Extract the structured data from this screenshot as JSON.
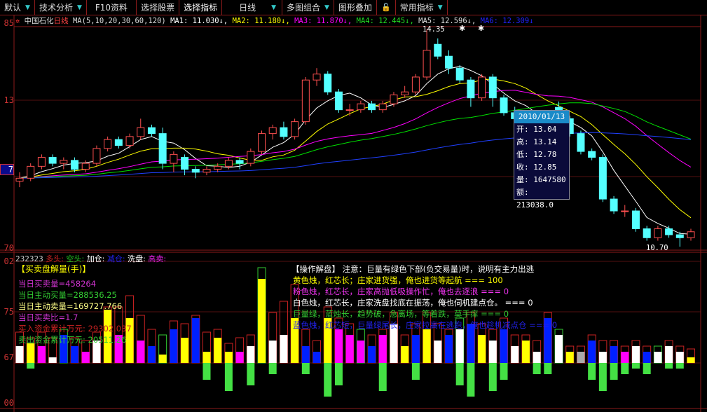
{
  "toolbar": {
    "items": [
      "默认",
      "技术分析",
      "F10资料",
      "选择股票",
      "选择指标",
      "日线",
      "多图组合",
      "图形叠加",
      "常用指标"
    ]
  },
  "info": {
    "stock": "中国石化",
    "period": "日线",
    "ma_params": "MA(5,10,20,30,60,120)",
    "ma1": "MA1: 11.030↓,",
    "ma2": "MA2: 11.180↓,",
    "ma3": "MA3: 11.870↓,",
    "ma4": "MA4: 12.445↓,",
    "ma5": "MA5: 12.596↓,",
    "ma6": "MA6: 12.309↓"
  },
  "axis": {
    "left_price": [
      "85",
      "13",
      "7",
      "70"
    ],
    "left_volume": [
      "02",
      "75",
      "67",
      "00"
    ]
  },
  "annotations": {
    "high": "14.35",
    "low": "10.70"
  },
  "tooltip": {
    "date": "2010/01/13",
    "open": "开: 13.04",
    "high": "高: 13.14",
    "low": "低: 12.78",
    "close": "收: 12.85",
    "volume": "量: 1647580",
    "amount": "额: 213038.0"
  },
  "volume_header": {
    "code": "232323",
    "items": [
      "多头:",
      "空头:",
      "加仓:",
      "减仓:",
      "洗盘:",
      "高卖:"
    ]
  },
  "left_panel": {
    "title": "【买卖盘解量(手)】",
    "lines": [
      "当日买卖量=458264",
      "当日主动买量=288536.25",
      "当日主动卖量=169727.766",
      "当日买卖比=1.7",
      "买入资金累计万元: 29302.037",
      "卖出资金累计万元: 20511.26"
    ]
  },
  "right_panel": {
    "title": "【操作解盘】 注意：巨量有绿色下部(负交易量)时，说明有主力出逃",
    "lines": [
      "黄色烛，红芯长；庄家进货强，俺也进货等起航 === 100",
      "粉色烛，红芯长，庄家高抛低吸操作忙，俺也去逐浪 === 0",
      "白色烛，红芯长，庄家洗盘找底在振荡，俺也伺机建点仓。 === 0",
      "巨量绿，蓝烛长，趋势破，急离场，等着跌，莫手痒 === 0",
      "蓝色烛，红芯短，巨量绿尾长，庄家拉高在逃跑，俺也趁机减点仓 === 0"
    ]
  },
  "colors": {
    "up": "#ff5050",
    "down": "#54ffff",
    "ma1": "#ffffff",
    "ma2": "#ffff00",
    "ma3": "#ff00ff",
    "ma4": "#00e000",
    "ma5": "#ffffff",
    "ma6": "#2040ff"
  },
  "chart_data": {
    "type": "candlestick",
    "price_range": [
      10.7,
      14.35
    ],
    "candles": [
      [
        11.8,
        11.95,
        11.7,
        11.85
      ],
      [
        11.85,
        12.1,
        11.8,
        12.05
      ],
      [
        12.05,
        12.25,
        12.0,
        12.2
      ],
      [
        12.2,
        12.25,
        12.05,
        12.1
      ],
      [
        12.1,
        12.2,
        12.0,
        12.15
      ],
      [
        12.15,
        12.2,
        11.95,
        12.0
      ],
      [
        12.0,
        12.15,
        11.95,
        12.1
      ],
      [
        12.1,
        12.4,
        12.05,
        12.35
      ],
      [
        12.35,
        12.55,
        12.3,
        12.5
      ],
      [
        12.5,
        12.55,
        12.35,
        12.4
      ],
      [
        12.4,
        12.6,
        12.35,
        12.55
      ],
      [
        12.55,
        12.85,
        12.5,
        12.7
      ],
      [
        12.7,
        12.75,
        12.55,
        12.6
      ],
      [
        12.6,
        12.7,
        12.0,
        12.1
      ],
      [
        12.1,
        12.3,
        11.95,
        12.25
      ],
      [
        12.2,
        12.25,
        11.9,
        12.0
      ],
      [
        12.0,
        12.05,
        11.85,
        11.95
      ],
      [
        11.95,
        12.05,
        11.9,
        12.0
      ],
      [
        12.0,
        12.1,
        11.95,
        12.05
      ],
      [
        12.05,
        12.2,
        12.0,
        12.15
      ],
      [
        12.15,
        12.2,
        12.0,
        12.1
      ],
      [
        12.1,
        12.35,
        12.05,
        12.3
      ],
      [
        12.3,
        12.65,
        12.25,
        12.6
      ],
      [
        12.6,
        12.75,
        12.5,
        12.7
      ],
      [
        12.7,
        12.8,
        12.5,
        12.55
      ],
      [
        12.55,
        12.85,
        12.5,
        12.8
      ],
      [
        12.8,
        13.55,
        12.75,
        13.5
      ],
      [
        13.5,
        13.7,
        13.4,
        13.6
      ],
      [
        13.6,
        13.65,
        13.25,
        13.3
      ],
      [
        13.3,
        13.35,
        12.95,
        13.0
      ],
      [
        13.0,
        13.1,
        12.9,
        13.0
      ],
      [
        13.0,
        13.15,
        12.95,
        13.1
      ],
      [
        13.1,
        13.15,
        12.95,
        13.0
      ],
      [
        13.0,
        13.15,
        12.95,
        13.1
      ],
      [
        13.1,
        13.3,
        13.05,
        13.25
      ],
      [
        13.25,
        13.4,
        13.2,
        13.3
      ],
      [
        13.3,
        13.6,
        13.25,
        13.55
      ],
      [
        13.55,
        14.35,
        13.5,
        14.0
      ],
      [
        14.1,
        14.2,
        13.85,
        13.9
      ],
      [
        13.9,
        14.0,
        13.6,
        13.7
      ],
      [
        13.7,
        13.75,
        13.45,
        13.5
      ],
      [
        13.5,
        13.55,
        13.05,
        13.2
      ],
      [
        13.2,
        13.6,
        13.15,
        13.55
      ],
      [
        13.55,
        13.6,
        13.05,
        13.2
      ],
      [
        13.2,
        13.25,
        12.9,
        12.95
      ],
      [
        12.95,
        13.05,
        12.8,
        12.85
      ],
      [
        12.85,
        12.95,
        12.75,
        12.8
      ],
      [
        12.8,
        12.95,
        12.75,
        12.9
      ],
      [
        12.9,
        12.95,
        12.8,
        12.85
      ],
      [
        13.04,
        13.14,
        12.78,
        12.85
      ],
      [
        12.85,
        12.9,
        12.55,
        12.6
      ],
      [
        12.6,
        12.65,
        12.25,
        12.3
      ],
      [
        12.3,
        12.35,
        12.15,
        12.2
      ],
      [
        12.2,
        12.25,
        11.45,
        11.5
      ],
      [
        11.5,
        11.55,
        11.25,
        11.3
      ],
      [
        11.3,
        11.4,
        11.2,
        11.3
      ],
      [
        11.3,
        11.35,
        10.95,
        11.0
      ],
      [
        11.0,
        11.05,
        10.8,
        10.85
      ],
      [
        10.85,
        11.05,
        10.8,
        11.0
      ],
      [
        11.0,
        11.05,
        10.85,
        10.9
      ],
      [
        10.9,
        10.95,
        10.7,
        10.85
      ],
      [
        10.85,
        11.0,
        10.8,
        10.95
      ]
    ],
    "volume_bars": [
      [
        "W",
        0.3,
        0.55,
        0
      ],
      [
        "Y",
        0.35,
        0.45,
        0.1
      ],
      [
        "M",
        0.3,
        0.55,
        0
      ],
      [
        "W",
        0.1,
        0.45,
        0
      ],
      [
        "B",
        0.5,
        0.6,
        0
      ],
      [
        "B",
        0.3,
        0.45,
        0
      ],
      [
        "M",
        0.2,
        0.4,
        0
      ],
      [
        "W",
        0.4,
        0.55,
        0
      ],
      [
        "Y",
        0.95,
        1.0,
        0
      ],
      [
        "M",
        0.5,
        1.0,
        0
      ],
      [
        "Y",
        0.8,
        1.2,
        0
      ],
      [
        "M",
        0.4,
        0.85,
        0
      ],
      [
        "B",
        0.3,
        0.6,
        0
      ],
      [
        "Y",
        0.15,
        0.5,
        0
      ],
      [
        "B",
        0.6,
        0.75,
        0
      ],
      [
        "Y",
        0.45,
        0.7,
        0
      ],
      [
        "B",
        0.8,
        0.85,
        0
      ],
      [
        "Y",
        0.2,
        0.55,
        0.3
      ],
      [
        "Y",
        0.45,
        0.6,
        0
      ],
      [
        "Y",
        0.2,
        0.35,
        0.5
      ],
      [
        "M",
        0.2,
        0.45,
        0
      ],
      [
        "W",
        0.3,
        0.5,
        0.4
      ],
      [
        "Y",
        1.5,
        1.7,
        0
      ],
      [
        "W",
        0.4,
        0.9,
        0.2
      ],
      [
        "W",
        0.5,
        1.1,
        0
      ],
      [
        "Y",
        0.8,
        1.4,
        0
      ],
      [
        "B",
        0.3,
        0.6,
        0.2
      ],
      [
        "B",
        0.2,
        0.4,
        0
      ],
      [
        "Y",
        0.8,
        1.0,
        0.6
      ],
      [
        "M",
        0.6,
        0.8,
        0.4
      ],
      [
        "M",
        0.5,
        0.7,
        0
      ],
      [
        "M",
        0.4,
        0.6,
        0
      ],
      [
        "B",
        0.3,
        0.5,
        0
      ],
      [
        "M",
        0.5,
        0.6,
        0.5
      ],
      [
        "W",
        0.7,
        0.9,
        0
      ],
      [
        "Y",
        0.3,
        0.5,
        0
      ],
      [
        "B",
        0.5,
        0.7,
        0.3
      ],
      [
        "Y",
        0.6,
        0.9,
        0
      ],
      [
        "W",
        0.4,
        0.7,
        0
      ],
      [
        "B",
        0.5,
        0.6,
        0
      ],
      [
        "W",
        0.6,
        0.8,
        0.4
      ],
      [
        "B",
        0.7,
        0.9,
        0.6
      ],
      [
        "Y",
        0.5,
        0.7,
        0
      ],
      [
        "W",
        0.4,
        0.6,
        0.5
      ],
      [
        "B",
        0.6,
        0.8,
        0.3
      ],
      [
        "W",
        0.3,
        0.5,
        0
      ],
      [
        "Y",
        0.4,
        0.5,
        0
      ],
      [
        "W",
        0.2,
        0.4,
        0.2
      ],
      [
        "B",
        0.8,
        0.9,
        0.2
      ],
      [
        "W",
        0.5,
        0.6,
        0
      ],
      [
        "Y",
        0.2,
        0.3,
        0
      ],
      [
        "G",
        0.2,
        0.3,
        0
      ],
      [
        "B",
        0.4,
        0.5,
        0.3
      ],
      [
        "W",
        0.2,
        0.4,
        0.5
      ],
      [
        "B",
        0.3,
        0.4,
        0.3
      ],
      [
        "M",
        0.2,
        0.3,
        0.2
      ],
      [
        "W",
        0.3,
        0.4,
        0.1
      ],
      [
        "B",
        0.2,
        0.3,
        0.2
      ],
      [
        "W",
        0.2,
        0.3,
        0
      ],
      [
        "W",
        0.3,
        0.4,
        0.1
      ],
      [
        "W",
        0.2,
        0.3,
        0.1
      ],
      [
        "Y",
        0.1,
        0.25,
        0
      ]
    ]
  }
}
